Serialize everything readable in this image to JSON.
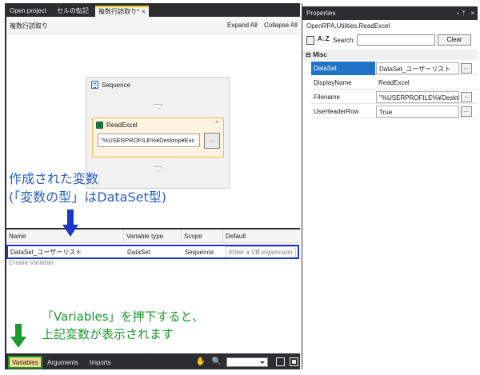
{
  "tabs": [
    {
      "label": "Open project"
    },
    {
      "label": "セルの転記"
    },
    {
      "label": "複数行読取り*",
      "close": "×"
    }
  ],
  "designer": {
    "breadcrumb": "複数行読取り",
    "expand_all": "Expand All",
    "collapse_all": "Collapse All",
    "sequence_title": "Sequence",
    "readexcel_title": "ReadExcel",
    "readexcel_collapse": "≈",
    "readexcel_filename": "\"%USERPROFILE%¥Desktop¥Exc",
    "browse_label": "..."
  },
  "variables": {
    "columns": [
      "Name",
      "Variable type",
      "Scope",
      "Default"
    ],
    "rows": [
      {
        "name": "DataSet_ユーザーリスト",
        "type": "DataSet",
        "scope": "Sequence",
        "default_placeholder": "Enter a VB expression"
      }
    ],
    "create_variable": "Create Variable"
  },
  "bottom_bar": {
    "variables": "Variables",
    "arguments": "Arguments",
    "imports": "Imports",
    "hand_icon": "✋",
    "zoom_icon": "🔍"
  },
  "properties": {
    "title": "Properties",
    "pin": "▾ ᛘ",
    "close": "×",
    "type_name": "OpenRPA.Utilities.ReadExcel",
    "sort_alpha": "A↓Z",
    "search_label": "Search:",
    "search_value": "",
    "clear_label": "Clear",
    "category": "Misc",
    "category_toggle": "⊟",
    "rows": [
      {
        "name": "DataSet",
        "value": "DataSet_ユーザーリスト",
        "has_button": true,
        "selected": true
      },
      {
        "name": "DisplayName",
        "value": "ReadExcel",
        "has_button": false,
        "selected": false
      },
      {
        "name": "Filename",
        "value": "\"%USERPROFILE%¥Deskto",
        "has_button": true,
        "selected": false
      },
      {
        "name": "UseHeaderRow",
        "value": "True",
        "has_button": true,
        "selected": false
      }
    ],
    "button_label": "..."
  },
  "annotations": {
    "created_line1": "作成された変数",
    "created_line2": "(「変数の型」はDataSet型)",
    "note_line1": "「Variables」を押下すると、",
    "note_line2": "上記変数が表示されます"
  },
  "colors": {
    "annotation_blue": "#1f37c9",
    "annotation_green": "#1a9a2c",
    "tab_accent": "#ffc400",
    "selection": "#1e75c8"
  }
}
